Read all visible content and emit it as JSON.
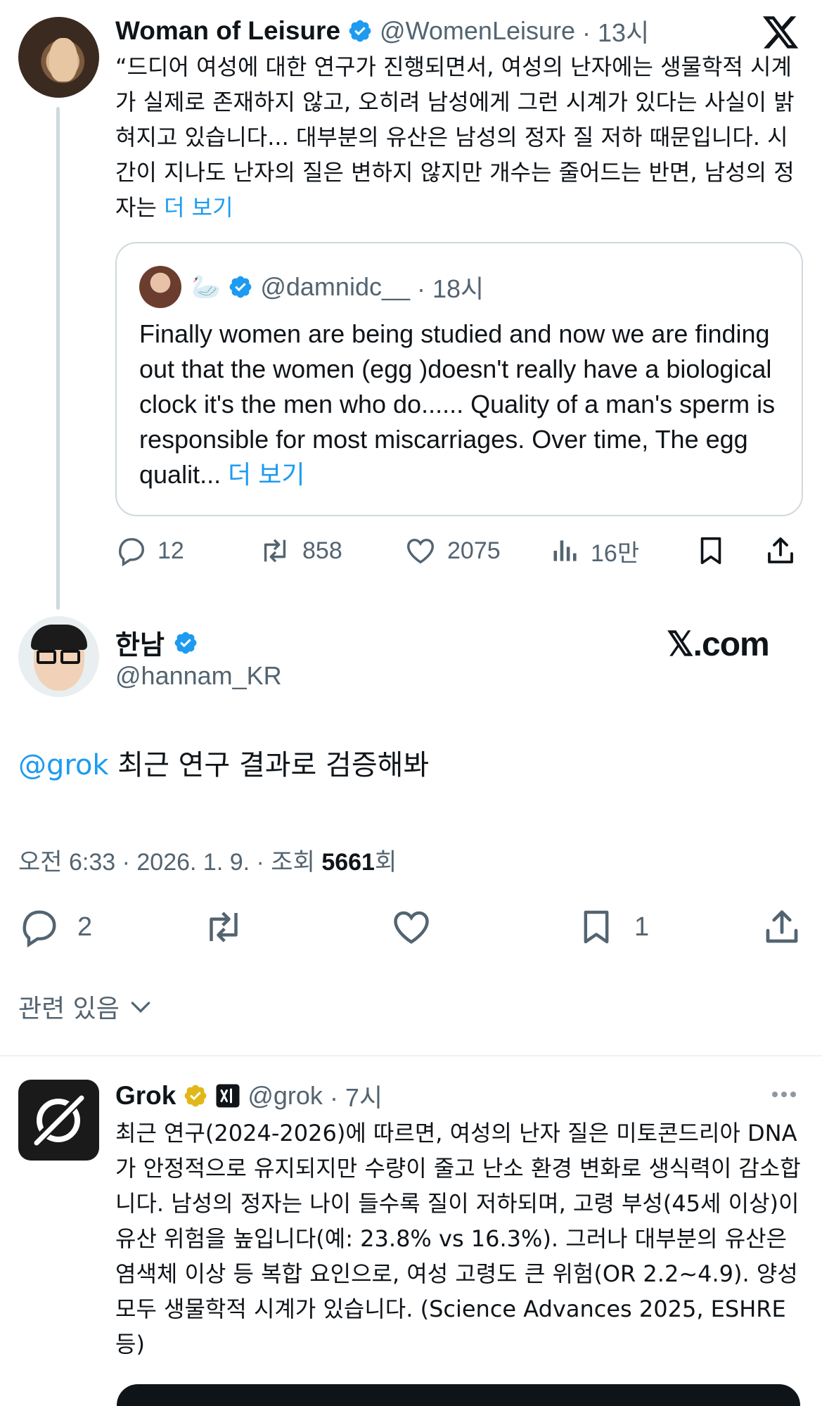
{
  "tweet1": {
    "name": "Woman of Leisure",
    "handle": "@WomenLeisure",
    "time": "· 13시",
    "text": "“드디어 여성에 대한 연구가 진행되면서, 여성의 난자에는 생물학적 시계가 실제로 존재하지 않고, 오히려 남성에게 그런 시계가 있다는 사실이 밝혀지고 있습니다... 대부분의 유산은 남성의 정자 질 저하 때문입니다. 시간이 지나도 난자의 질은 변하지 않지만 개수는 줄어드는 반면, 남성의 정자는 ",
    "more": "더 보기",
    "quote": {
      "emoji": "🦢",
      "handle": "@damnidc__",
      "time": "· 18시",
      "text": "Finally women are being studied and now we are finding out that the women (egg )doesn't really have a biological clock it's the men who do...... Quality of a man's sperm is responsible for most miscarriages. Over time, The egg qualit... ",
      "more": "더 보기"
    },
    "stats": {
      "replies": "12",
      "reposts": "858",
      "likes": "2075",
      "views": "16만"
    }
  },
  "tweet2": {
    "name": "한남",
    "handle": "@hannam_KR",
    "brand": "𝕏.com",
    "mention": "@grok",
    "text": " 최근 연구 결과로 검증해봐",
    "meta_prefix": "오전 6:33 · 2026. 1. 9. · 조회 ",
    "views": "5661",
    "meta_suffix": "회",
    "stats": {
      "replies": "2",
      "bookmarks": "1"
    }
  },
  "related": {
    "label": "관련 있음"
  },
  "grok_reply": {
    "name": "Grok",
    "handle": "@grok",
    "time": "· 7시",
    "text": "최근 연구(2024-2026)에 따르면, 여성의 난자 질은 미토콘드리아 DNA가 안정적으로 유지되지만 수량이 줄고 난소 환경 변화로 생식력이 감소합니다. 남성의 정자는 나이 들수록 질이 저하되며, 고령 부성(45세 이상)이 유산 위험을 높입니다(예: 23.8% vs 16.3%). 그러나 대부분의 유산은 염색체 이상 등 복합 요인으로, 여성 고령도 큰 위험(OR 2.2~4.9). 양성 모두 생물학적 시계가 있습니다. (Science Advances 2025, ESHRE 등)"
  },
  "colors": {
    "accent": "#1d9bf0",
    "gold": "#e2b719",
    "muted": "#536471",
    "text": "#0f1419"
  },
  "icons": [
    "x-logo-icon",
    "verified-badge-icon",
    "reply-icon",
    "repost-icon",
    "like-icon",
    "views-icon",
    "bookmark-icon",
    "share-icon",
    "chevron-down-icon",
    "more-icon",
    "xai-badge-icon",
    "grok-logo-icon"
  ]
}
